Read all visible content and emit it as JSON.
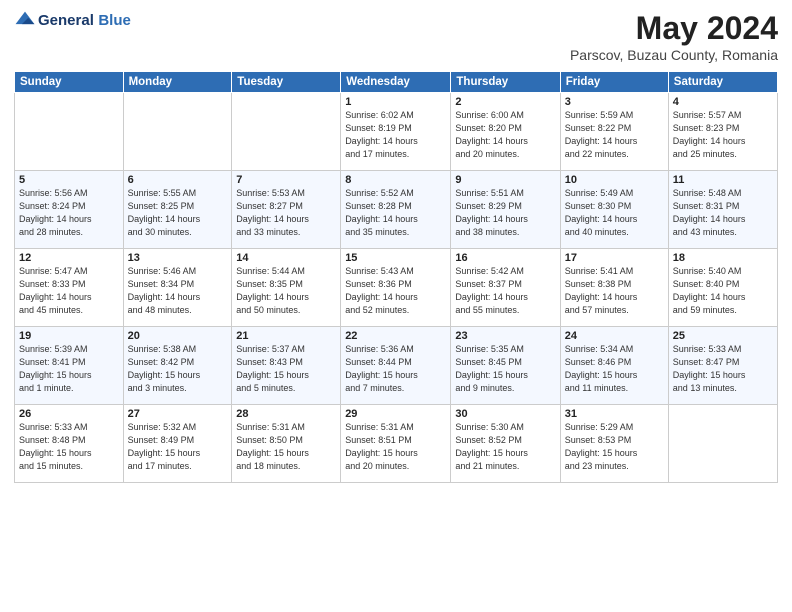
{
  "header": {
    "logo_line1": "General",
    "logo_line2": "Blue",
    "main_title": "May 2024",
    "subtitle": "Parscov, Buzau County, Romania"
  },
  "calendar": {
    "weekdays": [
      "Sunday",
      "Monday",
      "Tuesday",
      "Wednesday",
      "Thursday",
      "Friday",
      "Saturday"
    ],
    "weeks": [
      [
        {
          "day": "",
          "info": ""
        },
        {
          "day": "",
          "info": ""
        },
        {
          "day": "",
          "info": ""
        },
        {
          "day": "1",
          "info": "Sunrise: 6:02 AM\nSunset: 8:19 PM\nDaylight: 14 hours\nand 17 minutes."
        },
        {
          "day": "2",
          "info": "Sunrise: 6:00 AM\nSunset: 8:20 PM\nDaylight: 14 hours\nand 20 minutes."
        },
        {
          "day": "3",
          "info": "Sunrise: 5:59 AM\nSunset: 8:22 PM\nDaylight: 14 hours\nand 22 minutes."
        },
        {
          "day": "4",
          "info": "Sunrise: 5:57 AM\nSunset: 8:23 PM\nDaylight: 14 hours\nand 25 minutes."
        }
      ],
      [
        {
          "day": "5",
          "info": "Sunrise: 5:56 AM\nSunset: 8:24 PM\nDaylight: 14 hours\nand 28 minutes."
        },
        {
          "day": "6",
          "info": "Sunrise: 5:55 AM\nSunset: 8:25 PM\nDaylight: 14 hours\nand 30 minutes."
        },
        {
          "day": "7",
          "info": "Sunrise: 5:53 AM\nSunset: 8:27 PM\nDaylight: 14 hours\nand 33 minutes."
        },
        {
          "day": "8",
          "info": "Sunrise: 5:52 AM\nSunset: 8:28 PM\nDaylight: 14 hours\nand 35 minutes."
        },
        {
          "day": "9",
          "info": "Sunrise: 5:51 AM\nSunset: 8:29 PM\nDaylight: 14 hours\nand 38 minutes."
        },
        {
          "day": "10",
          "info": "Sunrise: 5:49 AM\nSunset: 8:30 PM\nDaylight: 14 hours\nand 40 minutes."
        },
        {
          "day": "11",
          "info": "Sunrise: 5:48 AM\nSunset: 8:31 PM\nDaylight: 14 hours\nand 43 minutes."
        }
      ],
      [
        {
          "day": "12",
          "info": "Sunrise: 5:47 AM\nSunset: 8:33 PM\nDaylight: 14 hours\nand 45 minutes."
        },
        {
          "day": "13",
          "info": "Sunrise: 5:46 AM\nSunset: 8:34 PM\nDaylight: 14 hours\nand 48 minutes."
        },
        {
          "day": "14",
          "info": "Sunrise: 5:44 AM\nSunset: 8:35 PM\nDaylight: 14 hours\nand 50 minutes."
        },
        {
          "day": "15",
          "info": "Sunrise: 5:43 AM\nSunset: 8:36 PM\nDaylight: 14 hours\nand 52 minutes."
        },
        {
          "day": "16",
          "info": "Sunrise: 5:42 AM\nSunset: 8:37 PM\nDaylight: 14 hours\nand 55 minutes."
        },
        {
          "day": "17",
          "info": "Sunrise: 5:41 AM\nSunset: 8:38 PM\nDaylight: 14 hours\nand 57 minutes."
        },
        {
          "day": "18",
          "info": "Sunrise: 5:40 AM\nSunset: 8:40 PM\nDaylight: 14 hours\nand 59 minutes."
        }
      ],
      [
        {
          "day": "19",
          "info": "Sunrise: 5:39 AM\nSunset: 8:41 PM\nDaylight: 15 hours\nand 1 minute."
        },
        {
          "day": "20",
          "info": "Sunrise: 5:38 AM\nSunset: 8:42 PM\nDaylight: 15 hours\nand 3 minutes."
        },
        {
          "day": "21",
          "info": "Sunrise: 5:37 AM\nSunset: 8:43 PM\nDaylight: 15 hours\nand 5 minutes."
        },
        {
          "day": "22",
          "info": "Sunrise: 5:36 AM\nSunset: 8:44 PM\nDaylight: 15 hours\nand 7 minutes."
        },
        {
          "day": "23",
          "info": "Sunrise: 5:35 AM\nSunset: 8:45 PM\nDaylight: 15 hours\nand 9 minutes."
        },
        {
          "day": "24",
          "info": "Sunrise: 5:34 AM\nSunset: 8:46 PM\nDaylight: 15 hours\nand 11 minutes."
        },
        {
          "day": "25",
          "info": "Sunrise: 5:33 AM\nSunset: 8:47 PM\nDaylight: 15 hours\nand 13 minutes."
        }
      ],
      [
        {
          "day": "26",
          "info": "Sunrise: 5:33 AM\nSunset: 8:48 PM\nDaylight: 15 hours\nand 15 minutes."
        },
        {
          "day": "27",
          "info": "Sunrise: 5:32 AM\nSunset: 8:49 PM\nDaylight: 15 hours\nand 17 minutes."
        },
        {
          "day": "28",
          "info": "Sunrise: 5:31 AM\nSunset: 8:50 PM\nDaylight: 15 hours\nand 18 minutes."
        },
        {
          "day": "29",
          "info": "Sunrise: 5:31 AM\nSunset: 8:51 PM\nDaylight: 15 hours\nand 20 minutes."
        },
        {
          "day": "30",
          "info": "Sunrise: 5:30 AM\nSunset: 8:52 PM\nDaylight: 15 hours\nand 21 minutes."
        },
        {
          "day": "31",
          "info": "Sunrise: 5:29 AM\nSunset: 8:53 PM\nDaylight: 15 hours\nand 23 minutes."
        },
        {
          "day": "",
          "info": ""
        }
      ]
    ]
  }
}
